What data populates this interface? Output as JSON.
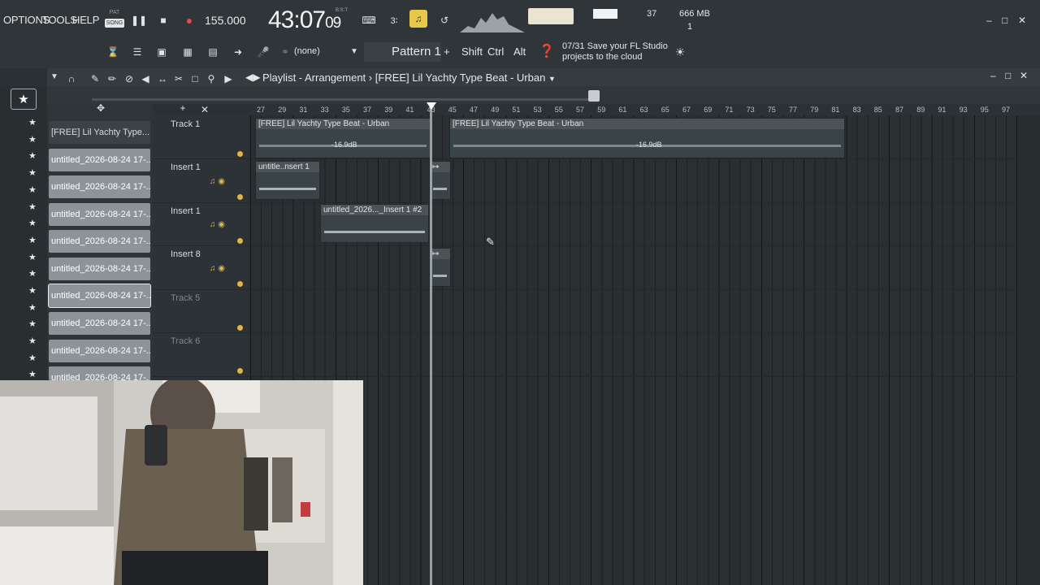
{
  "menu": [
    "OPTIONS",
    "TOOLS",
    "HELP"
  ],
  "transport": {
    "mode_top": "PAT",
    "mode_song": "SONG",
    "bpm": "155.000"
  },
  "clock": {
    "bars": "43:07",
    "sub": "09",
    "label": "B:S:T"
  },
  "meters": {
    "polyphony": "37",
    "memory": "666 MB",
    "cpu_cores": "1"
  },
  "toolbar2": {
    "pattern": "Pattern 1",
    "none_label": "(none)",
    "plus": "+",
    "shift": "Shift",
    "ctrl": "Ctrl",
    "alt": "Alt",
    "hint_count": "07/31",
    "hint_line1": "Save your FL Studio",
    "hint_line2": "projects to the cloud"
  },
  "playlist": {
    "title": "Playlist - Arrangement",
    "title_sep": "›",
    "pattern_name": "[FREE] Lil Yachty Type Beat - Urban"
  },
  "picker": {
    "first": "[FREE] Lil Yachty Type...",
    "items": [
      "untitled_2026-08-24 17-...",
      "untitled_2026-08-24 17-...",
      "untitled_2026-08-24 17-...",
      "untitled_2026-08-24 17-...",
      "untitled_2026-08-24 17-...",
      "untitled_2026-08-24 17-...",
      "untitled_2026-08-24 17-...",
      "untitled_2026-08-24 17-...",
      "untitled_2026-08-24 17-..."
    ]
  },
  "tracks": [
    "Track 1",
    "Insert 1",
    "Insert 1",
    "Insert 8",
    "Track 5",
    "Track 6"
  ],
  "ruler": [
    "27",
    "29",
    "31",
    "33",
    "35",
    "37",
    "39",
    "41",
    "43",
    "45",
    "47",
    "49",
    "51",
    "53",
    "55",
    "57",
    "59",
    "61",
    "63",
    "65",
    "67",
    "69",
    "71",
    "73",
    "75",
    "77",
    "79",
    "81",
    "83",
    "85",
    "87",
    "89",
    "91",
    "93",
    "95",
    "97"
  ],
  "clips": {
    "beat_a": "[FREE] Lil Yachty Type Beat - Urban",
    "beat_b": "[FREE] Lil Yachty Type Beat - Urban",
    "gain_a": "-16.9dB",
    "gain_b": "-16.9dB",
    "insert1": "untitle..nsert 1",
    "insert1_2": "untitled_2026..._Insert 1 #2"
  },
  "colors": {
    "accent": "#e0b64a",
    "record": "#e04a4a",
    "bg": "#2b3034"
  }
}
